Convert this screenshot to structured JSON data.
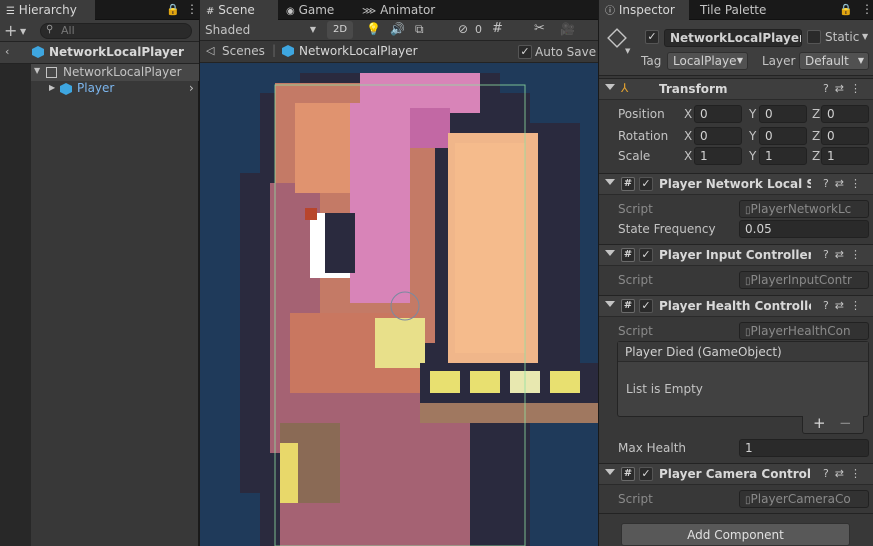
{
  "hierarchy": {
    "tab_label": "Hierarchy",
    "search_placeholder": "All",
    "breadcrumb": "NetworkLocalPlayer",
    "root_item": "NetworkLocalPlayer",
    "child_item": "Player"
  },
  "scene": {
    "tabs": [
      "Scene",
      "Game",
      "Animator"
    ],
    "shading_mode": "Shaded",
    "mode_2d": "2D",
    "gizmo_count": "0",
    "breadcrumb_root": "Scenes",
    "breadcrumb_object": "NetworkLocalPlayer",
    "auto_save_label": "Auto Save",
    "auto_save_checked": true
  },
  "inspector": {
    "tabs": [
      "Inspector",
      "Tile Palette"
    ],
    "object_name": "NetworkLocalPlayer",
    "static_label": "Static",
    "tag_label": "Tag",
    "tag_value": "LocalPlaye",
    "layer_label": "Layer",
    "layer_value": "Default",
    "transform": {
      "title": "Transform",
      "position_label": "Position",
      "rotation_label": "Rotation",
      "scale_label": "Scale",
      "axis_x": "X",
      "axis_y": "Y",
      "axis_z": "Z",
      "position": [
        "0",
        "0",
        "0"
      ],
      "rotation": [
        "0",
        "0",
        "0"
      ],
      "scale": [
        "1",
        "1",
        "1"
      ]
    },
    "components": [
      {
        "title": "Player Network Local Syn",
        "script_label": "Script",
        "script_value": "PlayerNetworkLc",
        "extra_label": "State Frequency",
        "extra_value": "0.05"
      },
      {
        "title": "Player Input Controller (Sc",
        "script_label": "Script",
        "script_value": "PlayerInputContr"
      },
      {
        "title": "Player Health Controller (S",
        "script_label": "Script",
        "script_value": "PlayerHealthCon",
        "event_title": "Player Died (GameObject)",
        "event_empty": "List is Empty",
        "extra_label": "Max Health",
        "extra_value": "1"
      },
      {
        "title": "Player Camera Controller",
        "script_label": "Script",
        "script_value": "PlayerCameraCo"
      }
    ],
    "add_component": "Add Component"
  },
  "colors": {
    "accent": "#3ea6e0",
    "scene_bg": "#1f3a5a",
    "panel_bg": "#383838"
  }
}
